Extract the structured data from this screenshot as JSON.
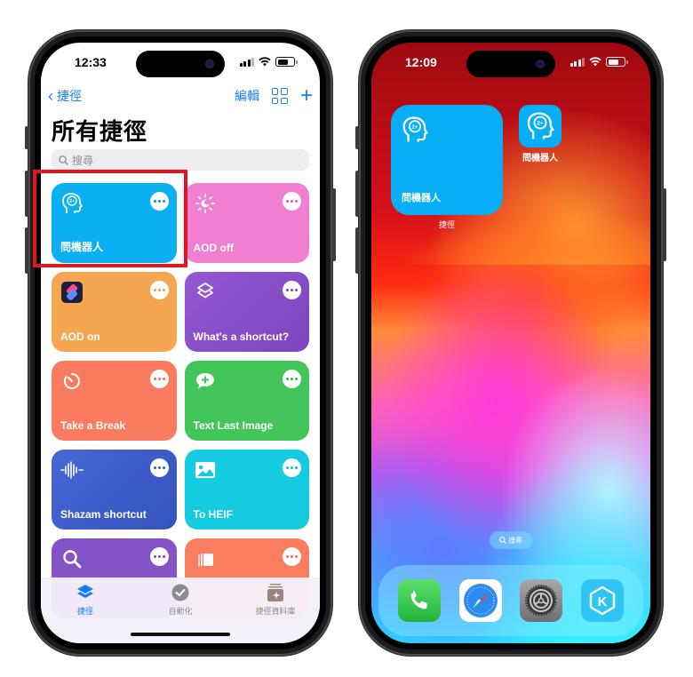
{
  "left_phone": {
    "status": {
      "time": "12:33"
    },
    "navbar": {
      "back_label": "捷徑",
      "edit_label": "編輯"
    },
    "title": "所有捷徑",
    "search": {
      "placeholder": "搜尋"
    },
    "cards": [
      {
        "label": "問機器人",
        "icon": "brain-head-icon",
        "color": "#0bb0f3",
        "more_dots": "#1a7cf5"
      },
      {
        "label": "AOD off",
        "icon": "sun-moon-icon",
        "color": "#f07ed1",
        "more_dots": "#e65aa0"
      },
      {
        "label": "AOD on",
        "icon": "shortcuts-app-icon",
        "color": "#f5a650",
        "more_dots": "#f39a3e"
      },
      {
        "label": "What's a shortcut?",
        "icon": "layers-icon",
        "color": "#8a51c9",
        "more_dots": "#7c46c2"
      },
      {
        "label": "Take a Break",
        "icon": "timer-icon",
        "color": "#fa7b5f",
        "more_dots": "#f66b4e"
      },
      {
        "label": "Text Last Image",
        "icon": "message-plus-icon",
        "color": "#42c65a",
        "more_dots": "#2fb34a"
      },
      {
        "label": "Shazam shortcut",
        "icon": "waveform-icon",
        "color": "#3f5fcc",
        "more_dots": "#3b57c2"
      },
      {
        "label": "To HEIF",
        "icon": "photo-icon",
        "color": "#14cbe0",
        "more_dots": "#0fb7cd"
      },
      {
        "label": "",
        "icon": "magnifier-icon",
        "color": "#8453c8",
        "more_dots": "#7a49c1"
      },
      {
        "label": "",
        "icon": "stack-cards-icon",
        "color": "#fa7d5f",
        "more_dots": "#f66b4e"
      }
    ],
    "tabs": [
      {
        "label": "捷徑",
        "icon": "layers-icon",
        "active": true
      },
      {
        "label": "自動化",
        "icon": "clock-check-icon",
        "active": false
      },
      {
        "label": "捷徑資料庫",
        "icon": "gallery-sparkle-icon",
        "active": false
      }
    ],
    "accent": "#1a7cf5",
    "highlight_color": "#e8131b"
  },
  "right_phone": {
    "status": {
      "time": "12:09"
    },
    "widget": {
      "label": "問機器人",
      "caption": "捷徑",
      "color": "#08aef5"
    },
    "app": {
      "label": "問機器人"
    },
    "home_search": "搜尋",
    "dock": [
      {
        "name": "phone-app",
        "icon": "phone-icon"
      },
      {
        "name": "safari-app",
        "icon": "compass-icon"
      },
      {
        "name": "settings-app",
        "icon": "gear-icon"
      },
      {
        "name": "kkbox-app",
        "icon": "k-hexagon-icon"
      }
    ]
  }
}
